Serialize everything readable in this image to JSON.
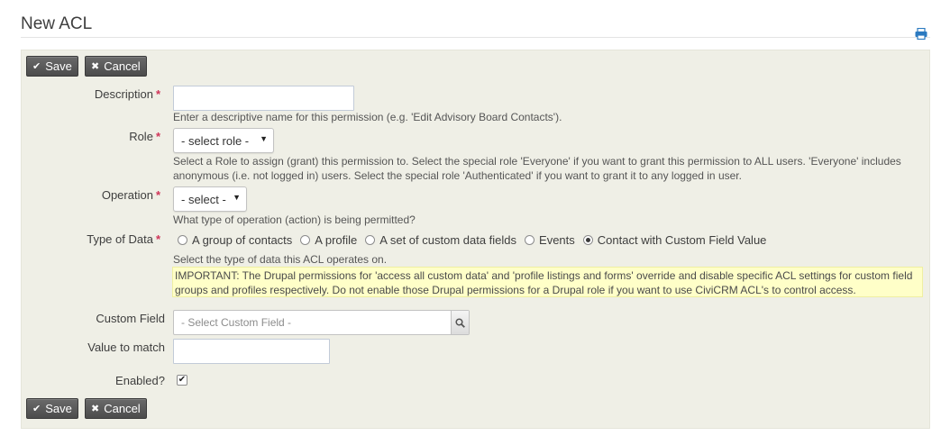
{
  "page": {
    "title": "New ACL"
  },
  "icons": {
    "print": "print-icon",
    "save": "check-icon",
    "cancel": "close-icon",
    "search": "search-icon",
    "dropdown": "caret-down-icon"
  },
  "buttons": {
    "save": "Save",
    "cancel": "Cancel"
  },
  "form": {
    "description": {
      "label": "Description",
      "required_mark": "*",
      "value": "",
      "help": "Enter a descriptive name for this permission (e.g. 'Edit Advisory Board Contacts')."
    },
    "role": {
      "label": "Role",
      "required_mark": "*",
      "selected": "- select role -",
      "help": "Select a Role to assign (grant) this permission to. Select the special role 'Everyone' if you want to grant this permission to ALL users. 'Everyone' includes anonymous (i.e. not logged in) users. Select the special role 'Authenticated' if you want to grant it to any logged in user."
    },
    "operation": {
      "label": "Operation",
      "required_mark": "*",
      "selected": "- select -",
      "help": "What type of operation (action) is being permitted?"
    },
    "type_of_data": {
      "label": "Type of Data",
      "required_mark": "*",
      "options": [
        {
          "label": "A group of contacts",
          "checked": false
        },
        {
          "label": "A profile",
          "checked": false
        },
        {
          "label": "A set of custom data fields",
          "checked": false
        },
        {
          "label": "Events",
          "checked": false
        },
        {
          "label": "Contact with Custom Field Value",
          "checked": true
        }
      ],
      "help": "Select the type of data this ACL operates on.",
      "important": "IMPORTANT: The Drupal permissions for 'access all custom data' and 'profile listings and forms' override and disable specific ACL settings for custom field groups and profiles respectively. Do not enable those Drupal permissions for a Drupal role if you want to use CiviCRM ACL's to control access."
    },
    "custom_field": {
      "label": "Custom Field",
      "placeholder": "- Select Custom Field -"
    },
    "value_to_match": {
      "label": "Value to match",
      "value": ""
    },
    "enabled": {
      "label": "Enabled?",
      "checked": true
    }
  },
  "colors": {
    "panel_bg": "#efefe6",
    "button_bg": "#555555",
    "required": "#cf3458",
    "important_bg": "#ffffc8",
    "print_icon": "#2b7ac0"
  }
}
